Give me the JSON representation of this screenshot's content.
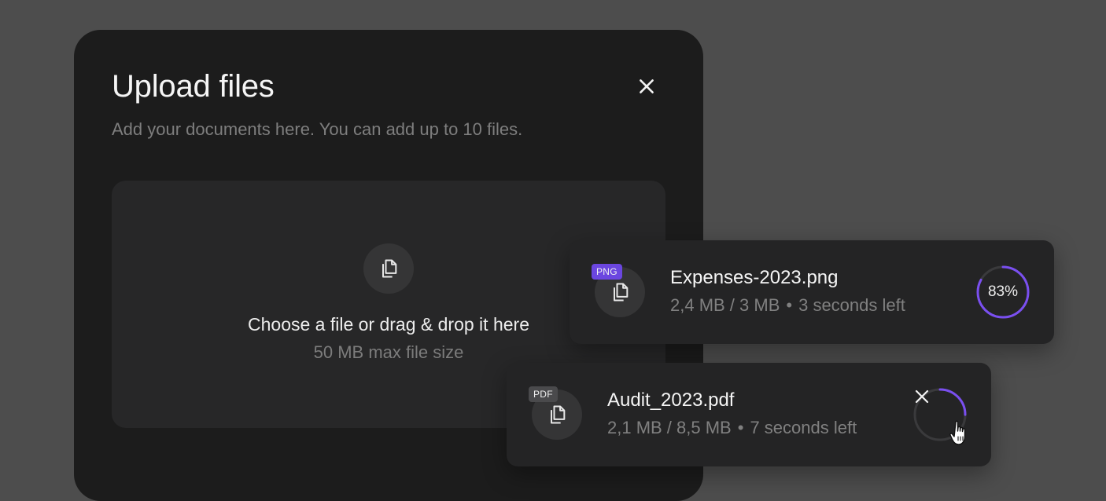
{
  "modal": {
    "title": "Upload files",
    "subtitle": "Add your documents here. You can add up to 10 files."
  },
  "dropzone": {
    "title": "Choose a file or drag & drop it here",
    "subtitle": "50 MB max file size",
    "icon": "file-copy-icon"
  },
  "files": [
    {
      "badge": "PNG",
      "badge_color": "#6b46e0",
      "name": "Expenses-2023.png",
      "size_progress": "2,4 MB / 3 MB",
      "time_left": "3 seconds left",
      "progress_percent": 83,
      "progress_label": "83%",
      "ring_color": "#7a4ff0"
    },
    {
      "badge": "PDF",
      "badge_color": "#4a4a4c",
      "name": "Audit_2023.pdf",
      "size_progress": "2,1 MB / 8,5 MB",
      "time_left": "7 seconds left",
      "progress_percent": 25,
      "ring_color": "#7a4ff0",
      "action_icon": "close-icon"
    }
  ],
  "meta_separator": "•"
}
